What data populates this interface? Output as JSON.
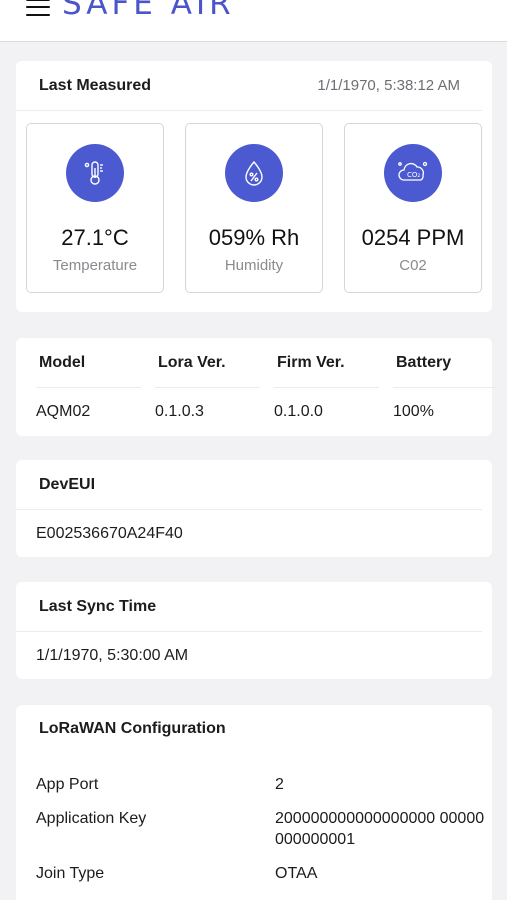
{
  "header": {
    "brand": "SAFE AIR"
  },
  "measured": {
    "title": "Last Measured",
    "timestamp": "1/1/1970, 5:38:12 AM",
    "metrics": [
      {
        "value": "27.1°C",
        "label": "Temperature",
        "icon": "thermometer-icon"
      },
      {
        "value": "059% Rh",
        "label": "Humidity",
        "icon": "humidity-drop-icon"
      },
      {
        "value": "0254 PPM",
        "label": "C02",
        "icon": "co2-cloud-icon"
      }
    ]
  },
  "device": {
    "headers": [
      "Model",
      "Lora Ver.",
      "Firm Ver.",
      "Battery"
    ],
    "values": [
      "AQM02",
      "0.1.0.3",
      "0.1.0.0",
      "100%"
    ]
  },
  "deveui": {
    "title": "DevEUI",
    "value": "E002536670A24F40"
  },
  "sync": {
    "title": "Last Sync Time",
    "value": "1/1/1970, 5:30:00 AM"
  },
  "lorawan": {
    "title": "LoRaWAN Configuration",
    "rows": [
      {
        "key": "App Port",
        "value": "2"
      },
      {
        "key": "Application Key",
        "value": "200000000000000000 00000000000001"
      },
      {
        "key": "Join Type",
        "value": "OTAA"
      }
    ]
  },
  "colors": {
    "accent": "#4b5ad0",
    "brand": "#4a55c8",
    "background": "#f2f2f4"
  }
}
